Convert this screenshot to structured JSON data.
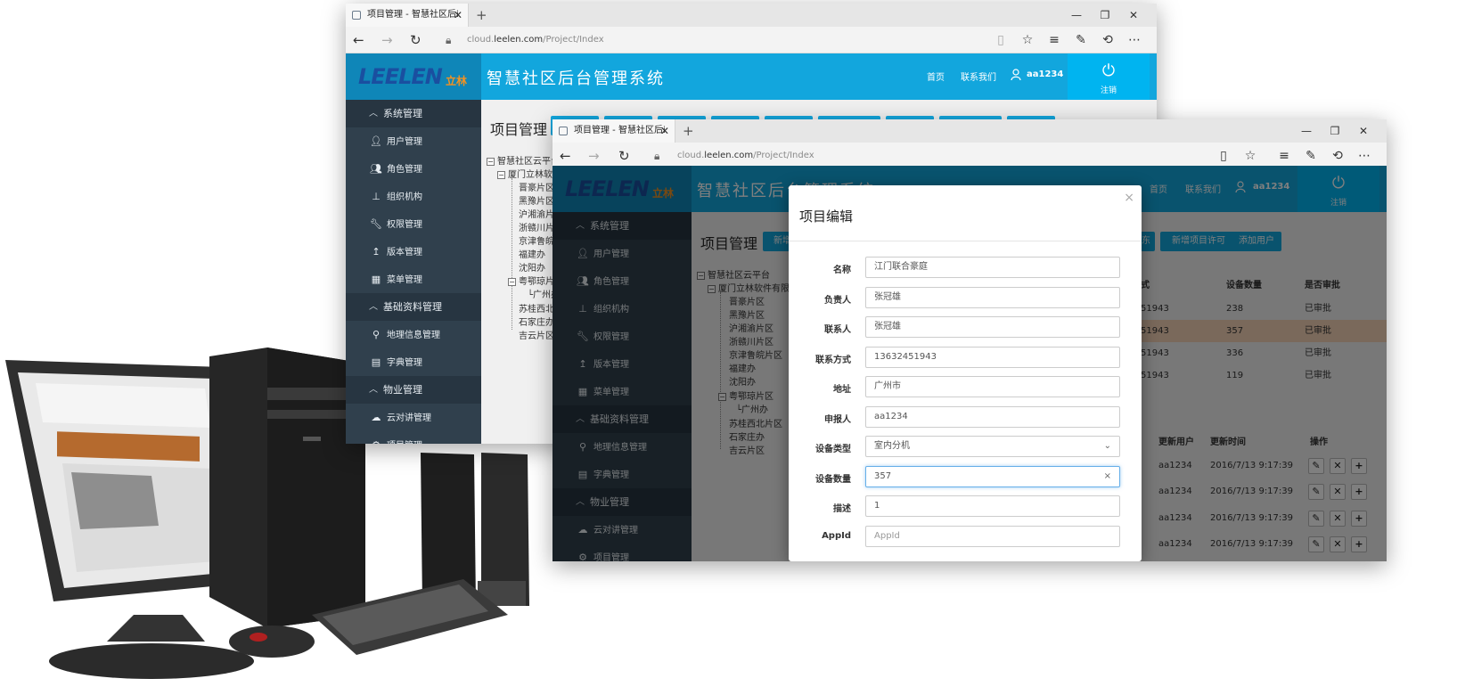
{
  "back_window": {
    "tab_title": "项目管理 - 智慧社区后i",
    "url_prefix": "cloud.",
    "url_domain": "leelen.com",
    "url_path": "/Project/Index"
  },
  "front_window": {
    "tab_title": "项目管理 - 智慧社区后i",
    "url_prefix": "cloud.",
    "url_domain": "leelen.com",
    "url_path": "/Project/Index"
  },
  "app": {
    "logo_text": "LEELEN",
    "logo_cn": "立林",
    "system_title": "智慧社区后台管理系统",
    "nav_home": "首页",
    "nav_contact": "联系我们",
    "username": "aa1234",
    "logout_label": "注销"
  },
  "sidebar": {
    "groups": [
      {
        "label": "系统管理",
        "items": [
          {
            "label": "用户管理",
            "icon": "user-icon"
          },
          {
            "label": "角色管理",
            "icon": "users-icon"
          },
          {
            "label": "组织机构",
            "icon": "sitemap-icon"
          },
          {
            "label": "权限管理",
            "icon": "wrench-icon"
          },
          {
            "label": "版本管理",
            "icon": "upload-icon"
          },
          {
            "label": "菜单管理",
            "icon": "grid-icon"
          }
        ]
      },
      {
        "label": "基础资料管理",
        "items": [
          {
            "label": "地理信息管理",
            "icon": "map-marker-icon"
          },
          {
            "label": "字典管理",
            "icon": "book-icon"
          }
        ]
      },
      {
        "label": "物业管理",
        "items": [
          {
            "label": "云对讲管理",
            "icon": "cloud-icon"
          },
          {
            "label": "项目管理",
            "icon": "gears-icon"
          }
        ]
      }
    ]
  },
  "content": {
    "page_title": "项目管理",
    "btn_new_short": "新增",
    "btn_suffix": "东",
    "btn_new_license": "新增项目许可",
    "btn_add_user": "添加用户",
    "tree": {
      "root": "智慧社区云平台",
      "company": "厦门立林软件有限公",
      "company_back": "厦门立林软件",
      "regions": [
        "晋豪片区",
        "黑豫片区",
        "沪湘渝片区",
        "浙赣川片区",
        "京津鲁皖片区",
        "福建办",
        "沈阳办"
      ],
      "regions_back": [
        "晋豪片区",
        "黑豫片区",
        "沪湘渝片",
        "浙赣川片",
        "京津鲁皖",
        "福建办",
        "沈阳办"
      ],
      "group": "粤鄂琼片区",
      "group_back": "粤鄂琼片",
      "group_child": "广州办",
      "others": [
        "苏桂西北片区",
        "石家庄办",
        "吉云片区"
      ],
      "others_back": [
        "苏桂西北",
        "石家庄办",
        "吉云片区"
      ]
    },
    "table1_headers": {
      "phone": "式",
      "device_count": "设备数量",
      "approved": "是否审批"
    },
    "table1_rows": [
      {
        "phone": "51943",
        "count": "238",
        "approved": "已审批"
      },
      {
        "phone": "51943",
        "count": "357",
        "approved": "已审批"
      },
      {
        "phone": "51943",
        "count": "336",
        "approved": "已审批"
      },
      {
        "phone": "51943",
        "count": "119",
        "approved": "已审批"
      }
    ],
    "table2_headers": {
      "updated_by": "更新用户",
      "updated_at": "更新时间",
      "ops": "操作"
    },
    "table2_rows": [
      {
        "user": "aa1234",
        "time": "2016/7/13 9:17:39"
      },
      {
        "user": "aa1234",
        "time": "2016/7/13 9:17:39"
      },
      {
        "user": "aa1234",
        "time": "2016/7/13 9:17:39"
      },
      {
        "user": "aa1234",
        "time": "2016/7/13 9:17:39"
      }
    ]
  },
  "modal": {
    "title": "项目编辑",
    "close": "×",
    "fields": [
      {
        "label": "名称",
        "value": "江门联合豪庭"
      },
      {
        "label": "负责人",
        "value": "张冠雄"
      },
      {
        "label": "联系人",
        "value": "张冠雄"
      },
      {
        "label": "联系方式",
        "value": "13632451943"
      },
      {
        "label": "地址",
        "value": "广州市"
      },
      {
        "label": "申报人",
        "value": "aa1234"
      },
      {
        "label": "设备类型",
        "value": "室内分机"
      },
      {
        "label": "设备数量",
        "value": "357"
      },
      {
        "label": "描述",
        "value": "1"
      },
      {
        "label": "AppId",
        "placeholder": "AppId"
      }
    ]
  },
  "colors": {
    "header_blue": "#12a6dd",
    "logout_blue": "#00b4f0",
    "sidebar_dark": "#30404d",
    "highlight_row": "#f4d2b6"
  }
}
